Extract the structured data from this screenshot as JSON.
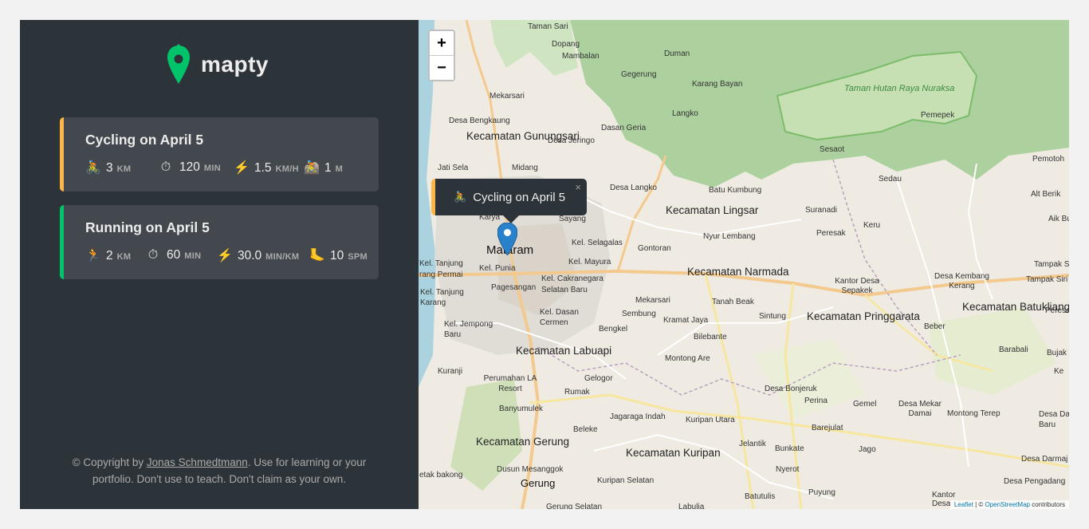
{
  "brand": {
    "name": "mapty",
    "color": "#00c46a"
  },
  "workouts": [
    {
      "type": "cycling",
      "title": "Cycling on April 5",
      "accent": "#ffb545",
      "stats": [
        {
          "icon": "🚴",
          "value": "3",
          "unit": "KM"
        },
        {
          "icon": "⏱",
          "value": "120",
          "unit": "MIN"
        },
        {
          "icon": "⚡️",
          "value": "1.5",
          "unit": "KM/H"
        },
        {
          "icon": "🚵",
          "value": "1",
          "unit": "M"
        }
      ]
    },
    {
      "type": "running",
      "title": "Running on April 5",
      "accent": "#00c46a",
      "stats": [
        {
          "icon": "🏃",
          "value": "2",
          "unit": "KM"
        },
        {
          "icon": "⏱",
          "value": "60",
          "unit": "MIN"
        },
        {
          "icon": "⚡️",
          "value": "30.0",
          "unit": "MIN/KM"
        },
        {
          "icon": "🦶",
          "value": "10",
          "unit": "SPM"
        }
      ]
    }
  ],
  "copyright": {
    "prefix": "© Copyright by ",
    "author": "Jonas Schmedtmann",
    "suffix": ". Use for learning or your portfolio. Don't use to teach. Don't claim as your own."
  },
  "map": {
    "zoom_in": "+",
    "zoom_out": "−",
    "popup": {
      "icon": "🚴",
      "text": "Cycling on April 5",
      "close": "×"
    },
    "attribution": {
      "leaflet": "Leaflet",
      "sep": " | © ",
      "osm": "OpenStreetMap",
      "suffix": " contributors"
    },
    "labels": [
      "Taman Sari",
      "Dopang",
      "Mambalan",
      "Duman",
      "Gegerung",
      "Karang Bayan",
      "Mekarsari",
      "Langko",
      "Taman Hutan Raya Nuraksa",
      "Pemepek",
      "Desa Bengkaung",
      "Dasan Geria",
      "Kecamatan Gunungsari",
      "Desa Jeringo",
      "Sesaot",
      "Pemotoh",
      "Jati Sela",
      "Midang",
      "Sedau",
      "Desa Langko",
      "Batu Kumbung",
      "Alt Berik",
      "Kecamatan Lingsar",
      "Suranadi",
      "Karya",
      "Sayang",
      "Nyur Lembang",
      "Peresak",
      "Keru",
      "Aik Bu",
      "Kel. Selagalas",
      "Mataram",
      "Gontoran",
      "Kel. Tanjung",
      "rang Permai",
      "Kel. Punia",
      "Kel. Mayura",
      "Kecamatan Narmada",
      "Tampak Sirir",
      "Desa Kembang Kerang",
      "Tampak Siri",
      "Kel. Cakranegara Selatan Baru",
      "Pagesangan",
      "Kantor Desa Sepakek",
      "Kel. Tanjung Karang",
      "Mekarsari",
      "Tanah Beak",
      "Kecamatan Batukliang",
      "Kel. Dasan Cermen",
      "Sembung",
      "Kramat Jaya",
      "Sintung",
      "Kecamatan Pringgarata",
      "Beber",
      "Peresa",
      "Kel. Jempong Baru",
      "Bengkel",
      "Bilebante",
      "Barabali",
      "Kecamatan Labuapi",
      "Bujak",
      "Montong Are",
      "Kuranji",
      "Perumahan LA Resort",
      "Gelogor",
      "Ke",
      "Rumak",
      "Desa Bonjeruk",
      "Perina",
      "Gemel",
      "Desa Mekar Damai",
      "Montong Terep",
      "Desa Da Baru",
      "Banyumulek",
      "Jagaraga Indah",
      "Kuripan Utara",
      "Barejulat",
      "Beleke",
      "Kecamatan Gerung",
      "Jelantik",
      "Bunkate",
      "Jago",
      "Kecamatan Kuripan",
      "Desa Darmaj",
      "Dusun Mesanggok",
      "Nyerot",
      "etak bakong",
      "Gerung",
      "Kuripan Selatan",
      "Desa Pengadang",
      "Puyung",
      "Batutulis",
      "Kantor Desa Bunut",
      "Gerung Selatan",
      "Labulia"
    ]
  }
}
